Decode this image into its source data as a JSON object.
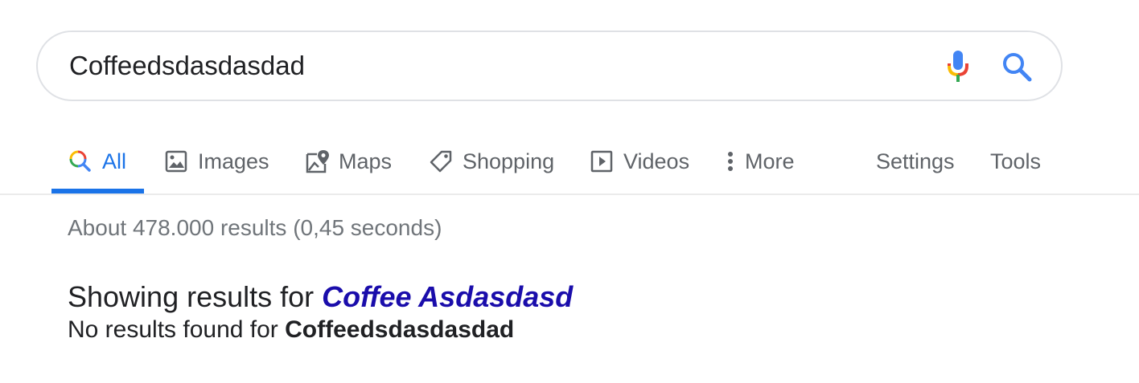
{
  "search": {
    "query": "Coffeedsdasdasdad"
  },
  "tabs": [
    {
      "label": "All",
      "icon": "search-icon",
      "active": true
    },
    {
      "label": "Images",
      "icon": "image-icon"
    },
    {
      "label": "Maps",
      "icon": "map-pin-icon"
    },
    {
      "label": "Shopping",
      "icon": "tag-icon"
    },
    {
      "label": "Videos",
      "icon": "play-icon"
    },
    {
      "label": "More",
      "icon": "more-vert-icon"
    }
  ],
  "tools": {
    "settings_label": "Settings",
    "tools_label": "Tools"
  },
  "results": {
    "stats": "About 478.000 results (0,45 seconds)",
    "showing_prefix": "Showing results for ",
    "corrected_query": "Coffee Asdasdasd",
    "no_results_prefix": "No results found for ",
    "original_query": "Coffeedsdasdasdad"
  },
  "colors": {
    "accent": "#1a73e8",
    "link": "#1a0dab",
    "text": "#202124",
    "muted": "#5f6368",
    "stats": "#70757a",
    "border": "#dfe1e5",
    "google_blue": "#4285f4",
    "google_red": "#ea4335",
    "google_yellow": "#fbbc05",
    "google_green": "#34a853"
  }
}
